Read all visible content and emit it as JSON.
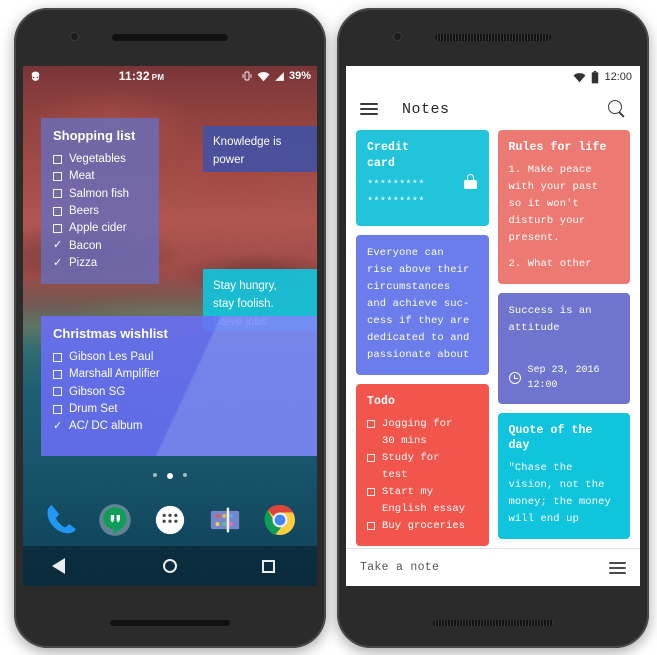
{
  "left_phone": {
    "statusbar": {
      "notification_icon": "cyanogenmod-icon",
      "time": "11:32",
      "ampm": "PM",
      "vibrate_icon": "vibrate-icon",
      "wifi_icon": "wifi-icon",
      "signal_icon": "signal-icon",
      "battery": "39%"
    },
    "widgets": {
      "shopping": {
        "title": "Shopping list",
        "items": [
          {
            "label": "Vegetables",
            "checked": false
          },
          {
            "label": "Meat",
            "checked": false
          },
          {
            "label": "Salmon fish",
            "checked": false
          },
          {
            "label": "Beers",
            "checked": false
          },
          {
            "label": "Apple cider",
            "checked": false
          },
          {
            "label": "Bacon",
            "checked": true
          },
          {
            "label": "Pizza",
            "checked": true
          }
        ],
        "color": "#676ebe"
      },
      "knowledge": {
        "lines": [
          "Knowledge is",
          "power"
        ],
        "color": "#3e52aa"
      },
      "steve": {
        "lines": [
          "Stay hungry,",
          "stay foolish.",
          "Steve jobs"
        ],
        "color": "#12c3db"
      },
      "christmas": {
        "title": "Christmas wishlist",
        "items": [
          {
            "label": "Gibson Les Paul",
            "checked": false
          },
          {
            "label": "Marshall Amplifier",
            "checked": false
          },
          {
            "label": "Gibson SG",
            "checked": false
          },
          {
            "label": "Drum Set",
            "checked": false
          },
          {
            "label": "AC/ DC album",
            "checked": true
          }
        ],
        "color": "#6a6ef6"
      }
    },
    "page_dots": [
      false,
      true,
      false
    ],
    "dock": [
      {
        "name": "phone-icon"
      },
      {
        "name": "hangouts-icon"
      },
      {
        "name": "app-drawer-icon"
      },
      {
        "name": "play-store-icon"
      },
      {
        "name": "chrome-icon"
      }
    ],
    "navbar": [
      {
        "name": "back-button"
      },
      {
        "name": "home-button"
      },
      {
        "name": "recents-button"
      }
    ]
  },
  "right_phone": {
    "statusbar": {
      "wifi_icon": "wifi-icon",
      "battery_icon": "battery-icon",
      "time": "12:00"
    },
    "appbar": {
      "menu_icon": "hamburger-menu-icon",
      "title": "Notes",
      "search_icon": "search-icon"
    },
    "notes": [
      {
        "id": "credit-card",
        "title": "Credit\ncard",
        "title_lines": [
          "Credit",
          "card"
        ],
        "body_lines": [
          "*********",
          "*********"
        ],
        "color": "#22c4dc",
        "locked": true,
        "lock_icon": "lock-icon",
        "column": 1
      },
      {
        "id": "rules-for-life",
        "title": "Rules for life",
        "title_lines": [
          "Rules for life"
        ],
        "body_lines": [
          "1. Make peace",
          "with your past",
          "so it won't",
          "disturb your",
          "present.",
          "",
          "2. What other"
        ],
        "color": "#ec7a72",
        "column": 2
      },
      {
        "id": "everyone-can-rise",
        "title": "",
        "title_lines": [],
        "body_lines": [
          "Everyone can",
          "rise above their",
          "circumstances",
          "and achieve suc-",
          "cess if they are",
          "dedicated to and",
          "passionate about"
        ],
        "color": "#6b7ceb",
        "column": 1
      },
      {
        "id": "success-attitude",
        "title": "",
        "title_lines": [],
        "body_lines": [
          "Success is an",
          "attitude"
        ],
        "color": "#6f75cf",
        "timestamp_icon": "clock-icon",
        "timestamp_lines": [
          "Sep 23, 2016",
          "12:00"
        ],
        "column": 2
      },
      {
        "id": "todo",
        "title": "Todo",
        "title_lines": [
          "Todo"
        ],
        "todo_items": [
          [
            "Jogging for",
            "30 mins"
          ],
          [
            "Study for",
            "test"
          ],
          [
            "Start my",
            "English essay"
          ],
          [
            "Buy groceries"
          ]
        ],
        "color": "#f1554c",
        "column": 1
      },
      {
        "id": "quote-of-the-day",
        "title": "Quote of the day",
        "title_lines": [
          "Quote of the",
          "day"
        ],
        "body_lines": [
          "\"Chase the",
          "vision, not the",
          "money; the money",
          "will end up"
        ],
        "color": "#0fc4dc",
        "column": 2
      }
    ],
    "bottom_bar": {
      "label": "Take a note",
      "list_icon": "list-view-icon"
    }
  }
}
